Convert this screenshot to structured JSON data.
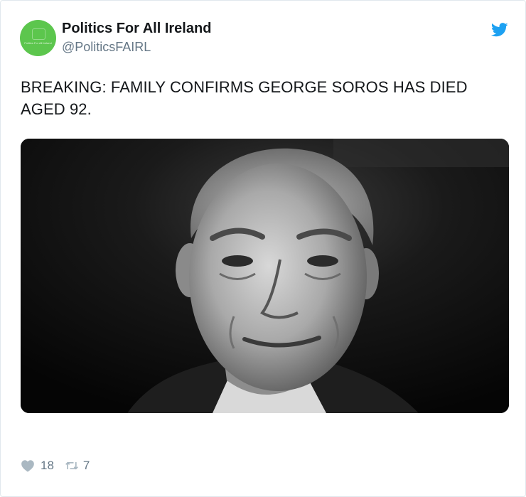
{
  "account": {
    "display_name": "Politics For All Ireland",
    "handle": "@PoliticsFAIRL"
  },
  "tweet": {
    "text": "BREAKING: FAMILY CONFIRMS GEORGE SOROS HAS DIED AGED 92."
  },
  "actions": {
    "like_count": "18",
    "retweet_count": "7"
  },
  "colors": {
    "avatar_bg": "#5cc64d",
    "twitter_blue": "#1da1f2",
    "muted_text": "#657786"
  },
  "icons": {
    "brand": "twitter-bird-icon",
    "like": "heart-icon",
    "retweet": "retweet-icon"
  }
}
